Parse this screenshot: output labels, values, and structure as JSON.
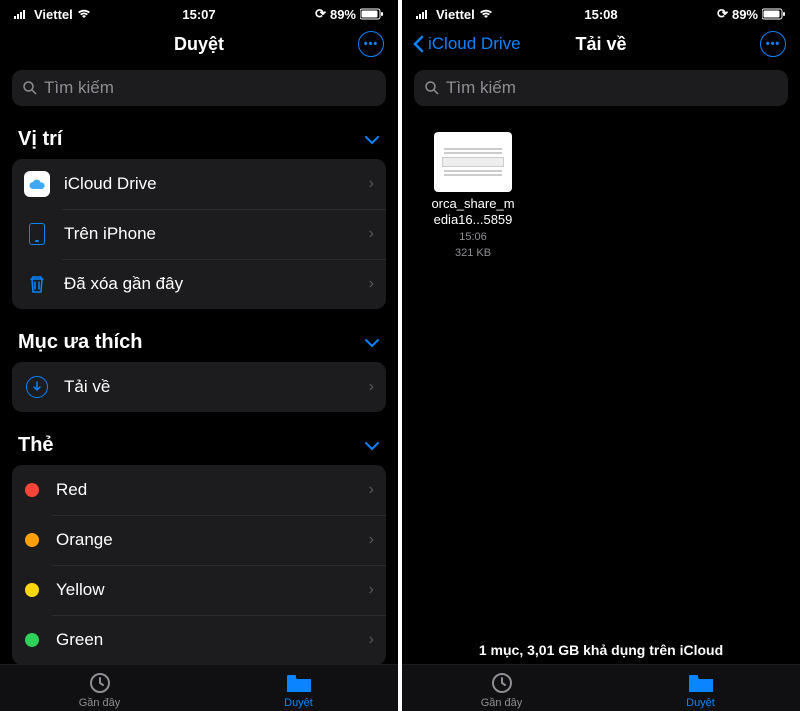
{
  "left": {
    "status": {
      "carrier": "Viettel",
      "time": "15:07",
      "battery": "89%"
    },
    "nav": {
      "title": "Duyệt"
    },
    "search": {
      "placeholder": "Tìm kiếm"
    },
    "sections": {
      "locations": {
        "title": "Vị trí",
        "icloud": "iCloud Drive",
        "oniphone": "Trên iPhone",
        "deleted": "Đã xóa gần đây"
      },
      "favorites": {
        "title": "Mục ưa thích",
        "downloads": "Tải về"
      },
      "tags": {
        "title": "Thẻ",
        "items": [
          {
            "label": "Red",
            "color": "#ff453a"
          },
          {
            "label": "Orange",
            "color": "#ff9f0a"
          },
          {
            "label": "Yellow",
            "color": "#ffd60a"
          },
          {
            "label": "Green",
            "color": "#30d158"
          }
        ]
      }
    },
    "tabs": {
      "recents": "Gần đây",
      "browse": "Duyệt"
    }
  },
  "right": {
    "status": {
      "carrier": "Viettel",
      "time": "15:08",
      "battery": "89%"
    },
    "nav": {
      "back": "iCloud Drive",
      "title": "Tải về"
    },
    "search": {
      "placeholder": "Tìm kiếm"
    },
    "file": {
      "name": "orca_share_media16...5859",
      "time": "15:06",
      "size": "321 KB"
    },
    "footer": "1 mục, 3,01 GB khả dụng trên iCloud",
    "tabs": {
      "recents": "Gần đây",
      "browse": "Duyệt"
    }
  }
}
